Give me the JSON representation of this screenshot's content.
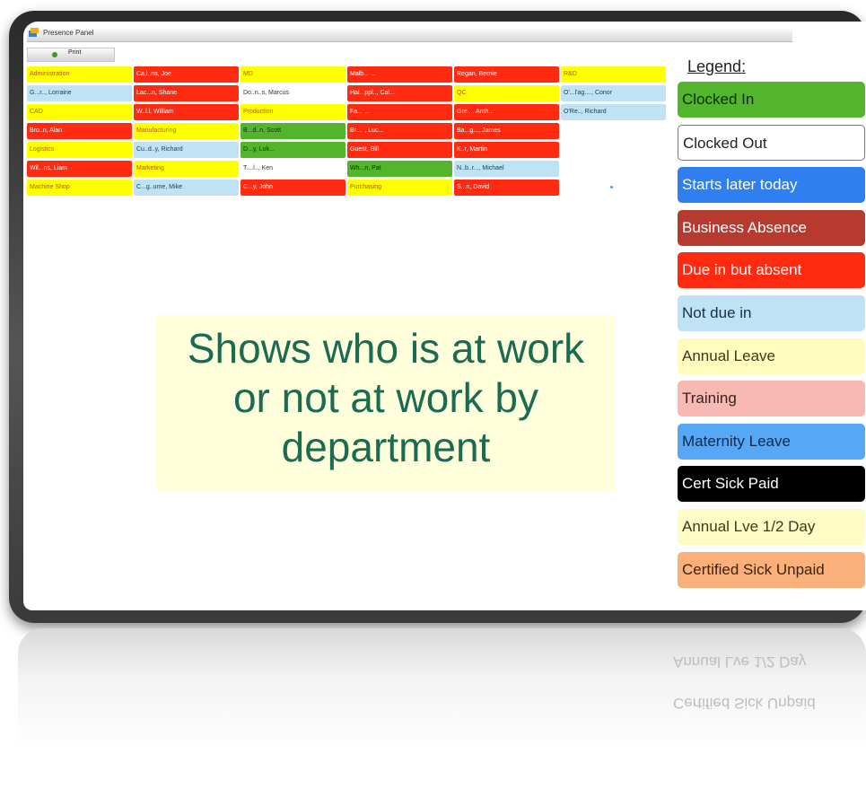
{
  "window": {
    "title": "Presence Panel"
  },
  "toolbar": {
    "print_label": "Print"
  },
  "grid": {
    "cells": [
      {
        "text": "Administration",
        "color": "yellow",
        "dept": true
      },
      {
        "text": "Ca,l..ns, Joe",
        "color": "red"
      },
      {
        "text": "MD",
        "color": "yellow",
        "dept": true
      },
      {
        "text": "Malb... ...",
        "color": "red"
      },
      {
        "text": "Regan, Bernie",
        "color": "red"
      },
      {
        "text": "R&D",
        "color": "yellow",
        "dept": true
      },
      {
        "text": "G...r.., Lorraine",
        "color": "lightblue"
      },
      {
        "text": "Lac...n, Shane",
        "color": "red"
      },
      {
        "text": "Do..n..s, Marcus",
        "color": "white"
      },
      {
        "text": "Hal...ppl.., Cal...",
        "color": "red"
      },
      {
        "text": "QC",
        "color": "yellow",
        "dept": true
      },
      {
        "text": "O'...l'ag...., Conor",
        "color": "lightblue"
      },
      {
        "text": "CAD",
        "color": "yellow",
        "dept": true
      },
      {
        "text": "W..l.l, William",
        "color": "red"
      },
      {
        "text": "Production",
        "color": "yellow",
        "dept": true
      },
      {
        "text": "Fa... ...",
        "color": "red"
      },
      {
        "text": "Gre.... Anth...",
        "color": "red"
      },
      {
        "text": "O'Re.., Richard",
        "color": "lightblue"
      },
      {
        "text": "Bro..n, Alan",
        "color": "red"
      },
      {
        "text": "Manufacturing",
        "color": "yellow",
        "dept": true
      },
      {
        "text": "B...d..n, Scott",
        "color": "green"
      },
      {
        "text": "Br.... , Luc...",
        "color": "red"
      },
      {
        "text": "Ba...g..., James",
        "color": "red"
      },
      {
        "text": "Logistics",
        "color": "yellow",
        "dept": true
      },
      {
        "text": "Cu..d..y, Richard",
        "color": "lightblue"
      },
      {
        "text": "D...y, Luk...",
        "color": "green"
      },
      {
        "text": "Guest, Bill",
        "color": "red"
      },
      {
        "text": "K..r, Martin",
        "color": "red"
      },
      {
        "text": "Wil...ns, Liam",
        "color": "red"
      },
      {
        "text": "Marketing",
        "color": "yellow",
        "dept": true
      },
      {
        "text": "T....l.., Ken",
        "color": "white"
      },
      {
        "text": "Wh...n, Pat",
        "color": "green"
      },
      {
        "text": "N..b..r..., Michael",
        "color": "lightblue"
      },
      {
        "text": "Machine Shop",
        "color": "yellow",
        "dept": true
      },
      {
        "text": "C...g..ume, Mike",
        "color": "lightblue"
      },
      {
        "text": "C...y, John",
        "color": "red"
      },
      {
        "text": "Purchasing",
        "color": "yellow",
        "dept": true
      },
      {
        "text": "S...n, David",
        "color": "red"
      }
    ]
  },
  "caption": {
    "line1": "Shows who is at work",
    "line2": "or not at work by",
    "line3": "department"
  },
  "legend": {
    "title": "Legend:",
    "items": [
      {
        "label": "Clocked In",
        "bg": "#52b52c",
        "fg": "#0e2a08",
        "border": "none"
      },
      {
        "label": "Clocked Out",
        "bg": "#ffffff",
        "fg": "#222222",
        "border": "1px solid #777777"
      },
      {
        "label": "Starts later today",
        "bg": "#2f7ff1",
        "fg": "#ffffff",
        "border": "none"
      },
      {
        "label": "Business Absence",
        "bg": "#b73a2e",
        "fg": "#ffffff",
        "border": "none"
      },
      {
        "label": "Due in but absent",
        "bg": "#ff2a10",
        "fg": "#ffffff",
        "border": "none"
      },
      {
        "label": "Not due in",
        "bg": "#bfe2f4",
        "fg": "#1a3040",
        "border": "none"
      },
      {
        "label": "Annual Leave",
        "bg": "#fffcbe",
        "fg": "#3a3a20",
        "border": "none"
      },
      {
        "label": "Training",
        "bg": "#f8b9b3",
        "fg": "#3a2020",
        "border": "none"
      },
      {
        "label": "Maternity Leave",
        "bg": "#56a7f5",
        "fg": "#0e2a50",
        "border": "none"
      },
      {
        "label": "Cert Sick Paid",
        "bg": "#000000",
        "fg": "#ffffff",
        "border": "none"
      },
      {
        "label": "Annual Lve 1/2 Day",
        "bg": "#fffbc4",
        "fg": "#3a3a20",
        "border": "none"
      },
      {
        "label": "Certified Sick Unpaid",
        "bg": "#fbb07a",
        "fg": "#3a2410",
        "border": "none"
      }
    ]
  },
  "colors": {
    "red": "#ff2a10",
    "yellow": "#ffff00",
    "lightblue": "#bfe2f4",
    "green": "#53b52b",
    "white": "#ffffff"
  },
  "reflection": {
    "items": [
      "Certified Sick Unpaid",
      "Annual Lve 1/2 Day"
    ]
  }
}
